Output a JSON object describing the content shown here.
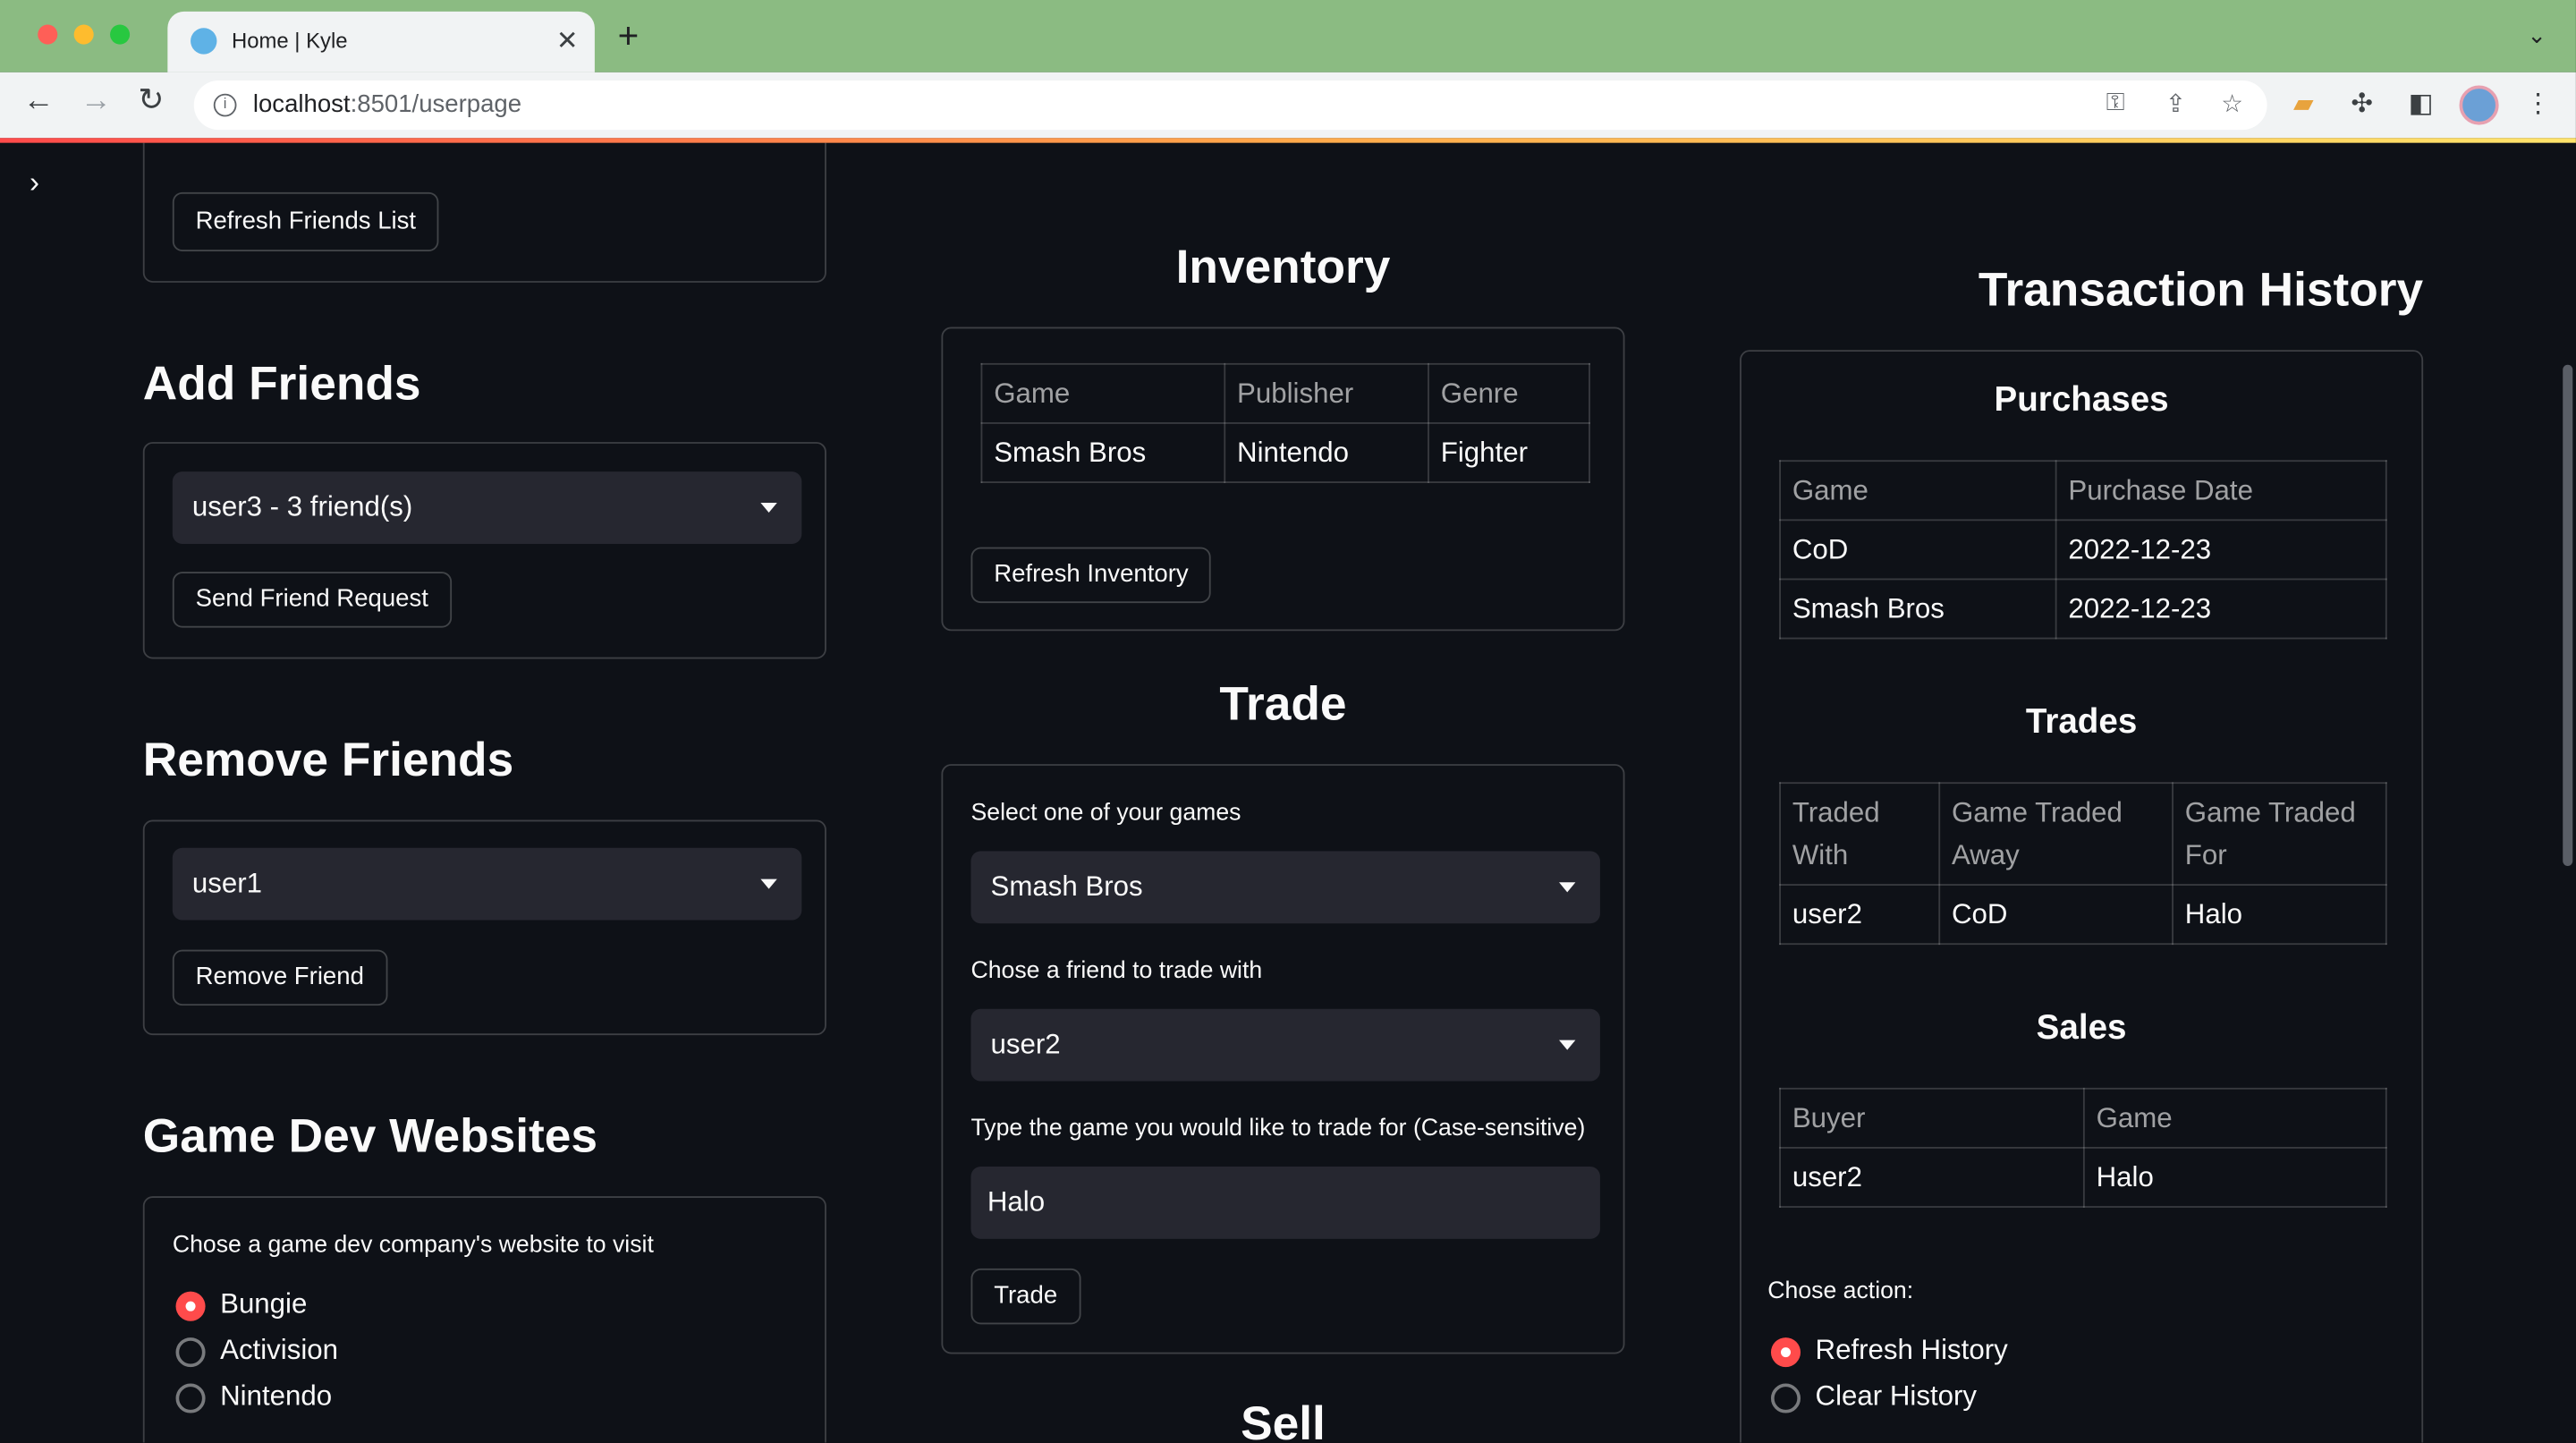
{
  "browser": {
    "tab_title": "Home | Kyle",
    "url_host": "localhost",
    "url_path": ":8501/userpage"
  },
  "left": {
    "refresh_friends_label": "Refresh Friends List",
    "add_friends": {
      "heading": "Add Friends",
      "selected": "user3 - 3 friend(s)",
      "button": "Send Friend Request"
    },
    "remove_friends": {
      "heading": "Remove Friends",
      "selected": "user1",
      "button": "Remove Friend"
    },
    "game_dev": {
      "heading": "Game Dev Websites",
      "prompt": "Chose a game dev company's website to visit",
      "options": [
        "Bungie",
        "Activision",
        "Nintendo"
      ],
      "selected_index": 0
    }
  },
  "middle": {
    "inventory": {
      "heading": "Inventory",
      "columns": [
        "Game",
        "Publisher",
        "Genre"
      ],
      "rows": [
        [
          "Smash Bros",
          "Nintendo",
          "Fighter"
        ]
      ],
      "button": "Refresh Inventory"
    },
    "trade": {
      "heading": "Trade",
      "game_label": "Select one of your games",
      "game_value": "Smash Bros",
      "friend_label": "Chose a friend to trade with",
      "friend_value": "user2",
      "wanted_label": "Type the game you would like to trade for (Case-sensitive)",
      "wanted_value": "Halo",
      "button": "Trade"
    },
    "sell_heading": "Sell"
  },
  "right": {
    "heading": "Transaction History",
    "purchases": {
      "heading": "Purchases",
      "columns": [
        "Game",
        "Purchase Date"
      ],
      "rows": [
        [
          "CoD",
          "2022-12-23"
        ],
        [
          "Smash Bros",
          "2022-12-23"
        ]
      ]
    },
    "trades": {
      "heading": "Trades",
      "columns": [
        "Traded With",
        "Game Traded Away",
        "Game Traded For"
      ],
      "rows": [
        [
          "user2",
          "CoD",
          "Halo"
        ]
      ]
    },
    "sales": {
      "heading": "Sales",
      "columns": [
        "Buyer",
        "Game"
      ],
      "rows": [
        [
          "user2",
          "Halo"
        ]
      ]
    },
    "action": {
      "label": "Chose action:",
      "options": [
        "Refresh History",
        "Clear History"
      ],
      "selected_index": 0
    }
  },
  "colors": {
    "accent": "#ff4b4b",
    "background": "#0e1117",
    "widget_bg": "#262730",
    "tabbar": "#8bbb82"
  }
}
